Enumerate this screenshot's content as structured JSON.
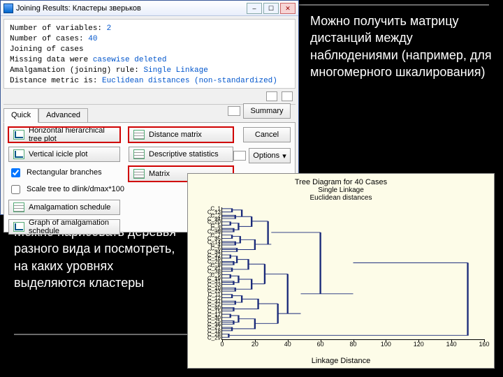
{
  "slide": {
    "text_right": "Можно получить матрицу дистанций между наблюдениями (например, для многомерного шкалирования)",
    "text_bottom": "Можно нарисовать деревья разного вида и посмотреть, на каких уровнях выделяются кластеры"
  },
  "dialog": {
    "title": "Joining Results: Кластеры зверьков",
    "info": {
      "l1a": "Number of variables: ",
      "l1b": "2",
      "l2a": "Number of cases: ",
      "l2b": "40",
      "l3": "Joining of cases",
      "l4a": "Missing data were ",
      "l4b": "casewise deleted",
      "l5a": "Amalgamation (joining) rule: ",
      "l5b": "Single Linkage",
      "l6a": "Distance metric is: ",
      "l6b": "Euclidean distances (non-standardized)"
    },
    "tabs": {
      "quick": "Quick",
      "advanced": "Advanced"
    },
    "buttons": {
      "hhtree": "Horizontal hierarchical tree plot",
      "vicicle": "Vertical icicle plot",
      "rect": "Rectangular branches",
      "scale": "Scale tree to dlink/dmax*100",
      "amalg": "Amalgamation schedule",
      "gamalg": "Graph of amalgamation schedule",
      "dist": "Distance matrix",
      "desc": "Descriptive statistics",
      "matrix": "Matrix",
      "summary": "Summary",
      "cancel": "Cancel",
      "options": "Options"
    }
  },
  "plot": {
    "title": "Tree Diagram for 40 Cases",
    "sub1": "Single Linkage",
    "sub2": "Euclidean distances",
    "xlabel": "Linkage Distance",
    "xticks": [
      "0",
      "20",
      "40",
      "60",
      "80",
      "100",
      "120",
      "140",
      "160"
    ],
    "yticks": [
      "C_1",
      "C_13",
      "C_2",
      "C_24",
      "C_20",
      "C_5",
      "C_3",
      "C_39",
      "C_7",
      "C_35",
      "C_14",
      "C_4",
      "C_6",
      "C_34",
      "C_32",
      "C_16",
      "C_26",
      "C_8",
      "C_21",
      "C_38",
      "C_9",
      "C_19",
      "C_31",
      "C_33",
      "C_10",
      "C_23",
      "C_11",
      "C_12",
      "C_37",
      "C_22",
      "C_40",
      "C_15",
      "C_17",
      "C_30",
      "C_25",
      "C_36",
      "C_27",
      "C_18",
      "C_28",
      "C_29"
    ]
  },
  "chart_data": {
    "type": "dendrogram",
    "title": "Tree Diagram for 40 Cases",
    "method": "Single Linkage",
    "metric": "Euclidean distances",
    "xlabel": "Linkage Distance",
    "xlim": [
      0,
      160
    ],
    "leaf_labels": [
      "C_1",
      "C_13",
      "C_2",
      "C_24",
      "C_20",
      "C_5",
      "C_3",
      "C_39",
      "C_7",
      "C_35",
      "C_14",
      "C_4",
      "C_6",
      "C_34",
      "C_32",
      "C_16",
      "C_26",
      "C_8",
      "C_21",
      "C_38",
      "C_9",
      "C_19",
      "C_31",
      "C_33",
      "C_10",
      "C_23",
      "C_11",
      "C_12",
      "C_37",
      "C_22",
      "C_40",
      "C_15",
      "C_17",
      "C_30",
      "C_25",
      "C_36",
      "C_27",
      "C_18",
      "C_28",
      "C_29"
    ],
    "note": "Hierarchical clustering dendrogram; merge heights range roughly 2–150. The image does not expose exact merge values per pair, so only leaf order and axis extents are captured."
  }
}
